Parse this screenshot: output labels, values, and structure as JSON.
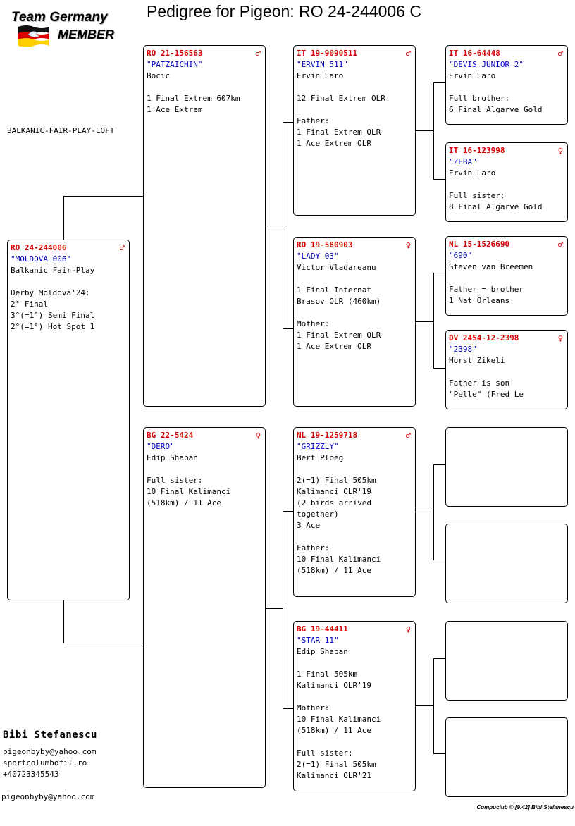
{
  "title": "Pedigree for Pigeon: RO  24-244006 C",
  "logo": {
    "line1": "Team Germany",
    "line2": "MEMBER"
  },
  "loft": "BALKANIC-FAIR-PLAY-LOFT",
  "colors": {
    "ring": "#d40000",
    "name": "#0000c0",
    "lines": "#000000"
  },
  "pigeons": {
    "subject": {
      "ring": "RO  24-244006",
      "sex": "♂",
      "name": "\"MOLDOVA 006\"",
      "owner": "Balkanic Fair-Play",
      "notes": "\nDerby Moldova'24:\n2° Final\n3°(=1°) Semi Final\n2°(=1°) Hot Spot 1"
    },
    "sire": {
      "ring": "RO  21-156563",
      "sex": "♂",
      "name": "\"PATZAICHIN\"",
      "owner": "Bocic",
      "notes": "\n1 Final Extrem 607km\n1 Ace Extrem"
    },
    "dam": {
      "ring": "BG  22-5424",
      "sex": "♀",
      "name": "\"DERO\"",
      "owner": "Edip Shaban",
      "notes": "\nFull sister:\n10 Final Kalimanci\n(518km) / 11 Ace"
    },
    "ss": {
      "ring": "IT  19-9090511",
      "sex": "♂",
      "name": "\"ERVIN 511\"",
      "owner": "Ervin Laro",
      "notes": "\n12 Final Extrem OLR\n\nFather:\n1 Final Extrem OLR\n1 Ace Extrem OLR"
    },
    "sd": {
      "ring": "RO  19-580903",
      "sex": "♀",
      "name": "\"LADY 03\"",
      "owner": "Victor Vladareanu",
      "notes": "\n1 Final Internat\nBrasov OLR (460km)\n\nMother:\n1 Final Extrem OLR\n1 Ace Extrem OLR"
    },
    "ds": {
      "ring": "NL  19-1259718",
      "sex": "♂",
      "name": "\"GRIZZLY\"",
      "owner": "Bert Ploeg",
      "notes": "\n2(=1) Final 505km\nKalimanci OLR'19\n(2 birds arrived\ntogether)\n3 Ace\n\nFather:\n10 Final Kalimanci\n(518km) / 11 Ace"
    },
    "dd": {
      "ring": "BG  19-44411",
      "sex": "♀",
      "name": "\"STAR 11\"",
      "owner": "Edip Shaban",
      "notes": "\n1 Final 505km\nKalimanci OLR'19\n\nMother:\n10 Final Kalimanci\n(518km) / 11 Ace\n\nFull sister:\n2(=1) Final 505km\nKalimanci OLR'21"
    },
    "sss": {
      "ring": "IT  16-64448",
      "sex": "♂",
      "name": "\"DEVIS JUNIOR 2\"",
      "owner": "Ervin Laro",
      "notes": "\nFull brother:\n6 Final Algarve Gold"
    },
    "ssd": {
      "ring": "IT  16-123998",
      "sex": "♀",
      "name": "\"ZEBA\"",
      "owner": "Ervin Laro",
      "notes": "\nFull sister:\n8 Final Algarve Gold"
    },
    "sds": {
      "ring": "NL  15-1526690",
      "sex": "♂",
      "name": "\"690\"",
      "owner": "Steven van Breemen",
      "notes": "\nFather = brother\n1 Nat Orleans"
    },
    "sdd": {
      "ring": "DV  2454-12-2398",
      "sex": "♀",
      "name": "\"2398\"",
      "owner": "Horst Zikeli",
      "notes": "\nFather is son\n\"Pelle\" (Fred Le"
    }
  },
  "breeder": {
    "name": "Bibi Stefanescu",
    "email": "pigeonbyby@yahoo.com",
    "website": "sportcolumbofil.ro",
    "phone": "+40723345543"
  },
  "footer": {
    "email": "pigeonbyby@yahoo.com",
    "credit": "Compuclub © [9.42]  Bibi Stefanescu"
  }
}
